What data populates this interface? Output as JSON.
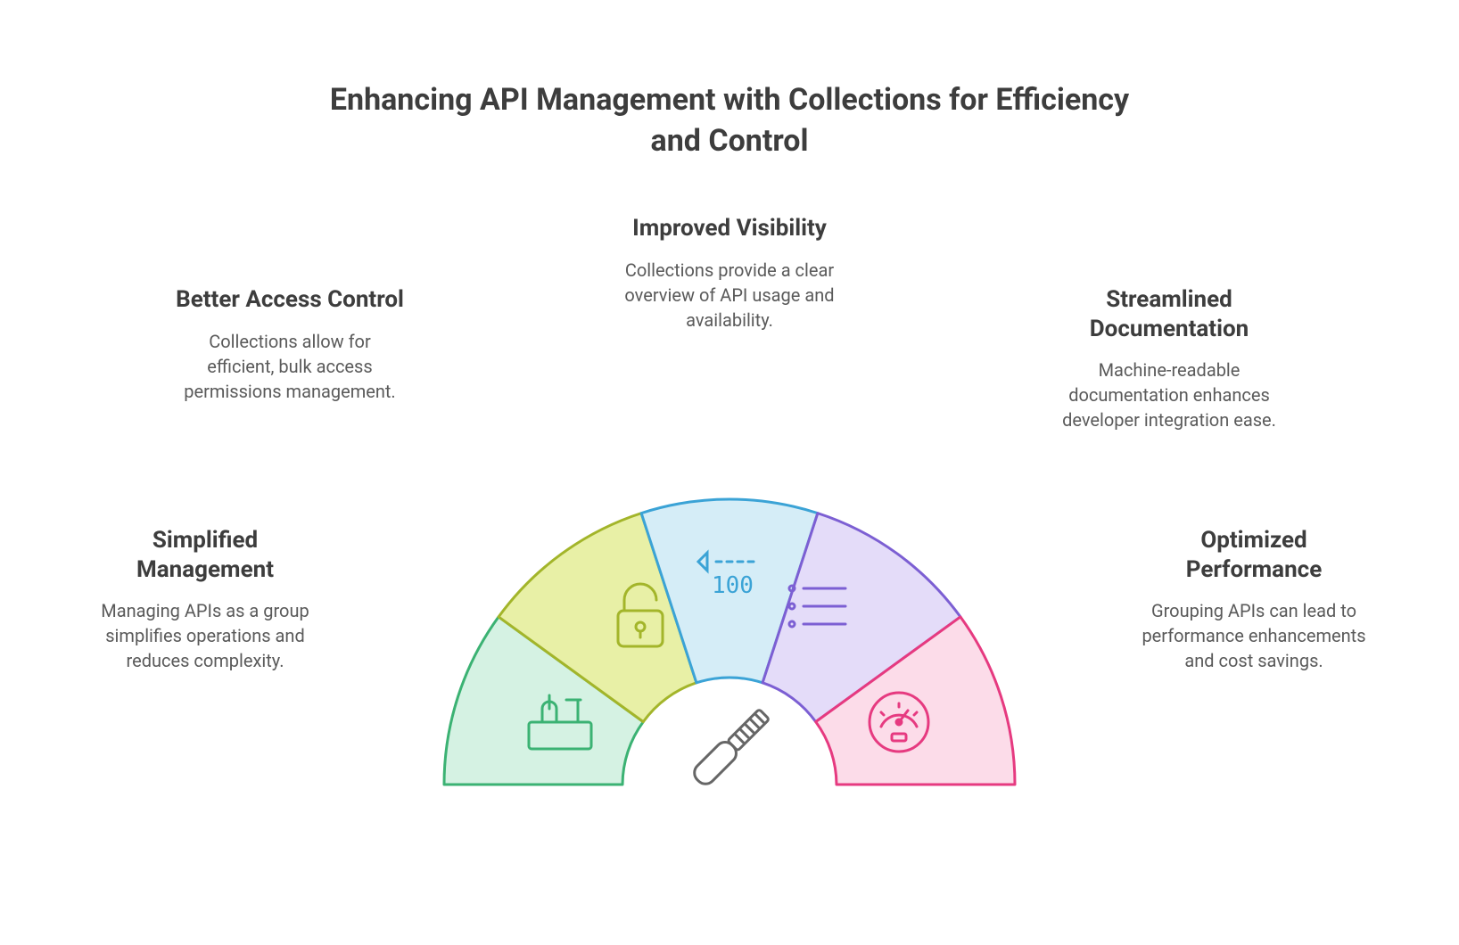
{
  "title": "Enhancing API Management with Collections for Efficiency and Control",
  "segments": [
    {
      "heading": "Simplified Management",
      "body": "Managing APIs as a group simplifies operations and reduces complexity.",
      "icon": "toolbox-icon",
      "fill": "#d5f2e3",
      "stroke": "#3bb273"
    },
    {
      "heading": "Better Access Control",
      "body": "Collections allow for efficient, bulk access permissions management.",
      "icon": "unlock-icon",
      "fill": "#e8f0a6",
      "stroke": "#a3b52a"
    },
    {
      "heading": "Improved Visibility",
      "body": "Collections provide a clear overview of API usage and availability.",
      "icon": "code-metric-icon",
      "fill": "#d5edf7",
      "stroke": "#3ba3d6"
    },
    {
      "heading": "Streamlined Documentation",
      "body": "Machine-readable documentation enhances developer integration ease.",
      "icon": "list-icon",
      "fill": "#e4dcf9",
      "stroke": "#7c5fd3"
    },
    {
      "heading": "Optimized Performance",
      "body": "Grouping APIs can lead to performance enhancements and cost savings.",
      "icon": "gauge-icon",
      "fill": "#fcdce9",
      "stroke": "#e63a80"
    }
  ],
  "center_icon": "screwdriver-icon"
}
